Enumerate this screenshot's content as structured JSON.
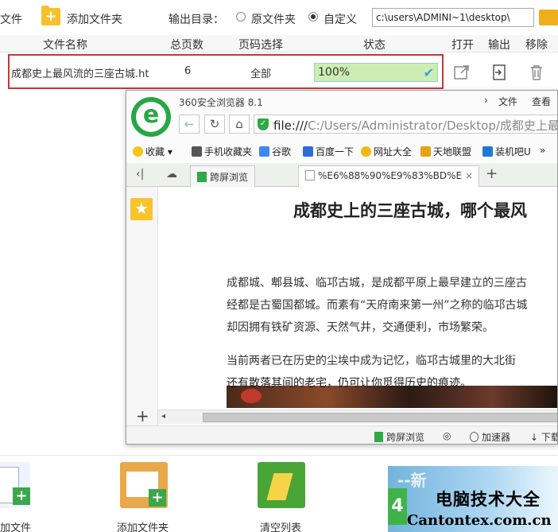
{
  "toolbar": {
    "add_file_label": "文件",
    "add_folder_label": "添加文件夹",
    "output_dir_label": "输出目录：",
    "option_source_folder": "原文件夹",
    "option_custom": "自定义",
    "selected_option": "自定义",
    "output_path": "c:\\users\\ADMINI~1\\desktop\\"
  },
  "table": {
    "headers": {
      "name": "文件名称",
      "pages": "总页数",
      "page_range": "页码选择",
      "status": "状态",
      "open": "打开",
      "output": "输出",
      "remove": "移除"
    },
    "rows": [
      {
        "name": "成都史上最风流的三座古城.ht",
        "pages": "6",
        "page_range": "全部",
        "progress_text": "100%",
        "progress": 1.0
      }
    ]
  },
  "bottom_bar": {
    "add_file_label": "加文件",
    "add_folder_label": "添加文件夹",
    "clear_list_label": "清空列表"
  },
  "watermark": {
    "faint_text": "--新",
    "title": "电脑技术大全",
    "url": "Cantontex.com.cn"
  },
  "browser": {
    "app_name": "360安全浏览器 8.1",
    "menu_file": "文件",
    "menu_view": "查看",
    "address_scheme": "file:///",
    "address_path": "C:/Users/Administrator/Desktop/成都史上最",
    "bookmarks": [
      "收藏",
      "手机收藏夹",
      "谷歌",
      "百度一下",
      "网址大全",
      "天地联盟",
      "装机吧U"
    ],
    "tabs": [
      {
        "label": "跨屏浏览"
      },
      {
        "label": "%E6%88%90%E9%83%BD%E"
      }
    ],
    "article": {
      "title": "成都史上的三座古城，哪个最风",
      "paragraphs": [
        "成都城、郫县城、临邛古城，是成都平原上最早建立的三座古",
        "经都是古蜀国都城。而素有“天府南来第一州”之称的临邛古城",
        "却因拥有铁矿资源、天然气井，交通便利，市场繁荣。",
        "当前两者已在历史的尘埃中成为记忆，临邛古城里的大北街",
        "还有散落其间的老宅，仍可让你觅得历史的痕迹。"
      ]
    },
    "status": {
      "cross_screen": "跨屏浏览",
      "accelerator": "加速器",
      "download": "下载"
    }
  },
  "colors": {
    "highlight_border": "#c0393b",
    "progress_fill": "#cdeeb2",
    "logo_green": "#25a844",
    "folder_yellow": "#f7c12c"
  }
}
